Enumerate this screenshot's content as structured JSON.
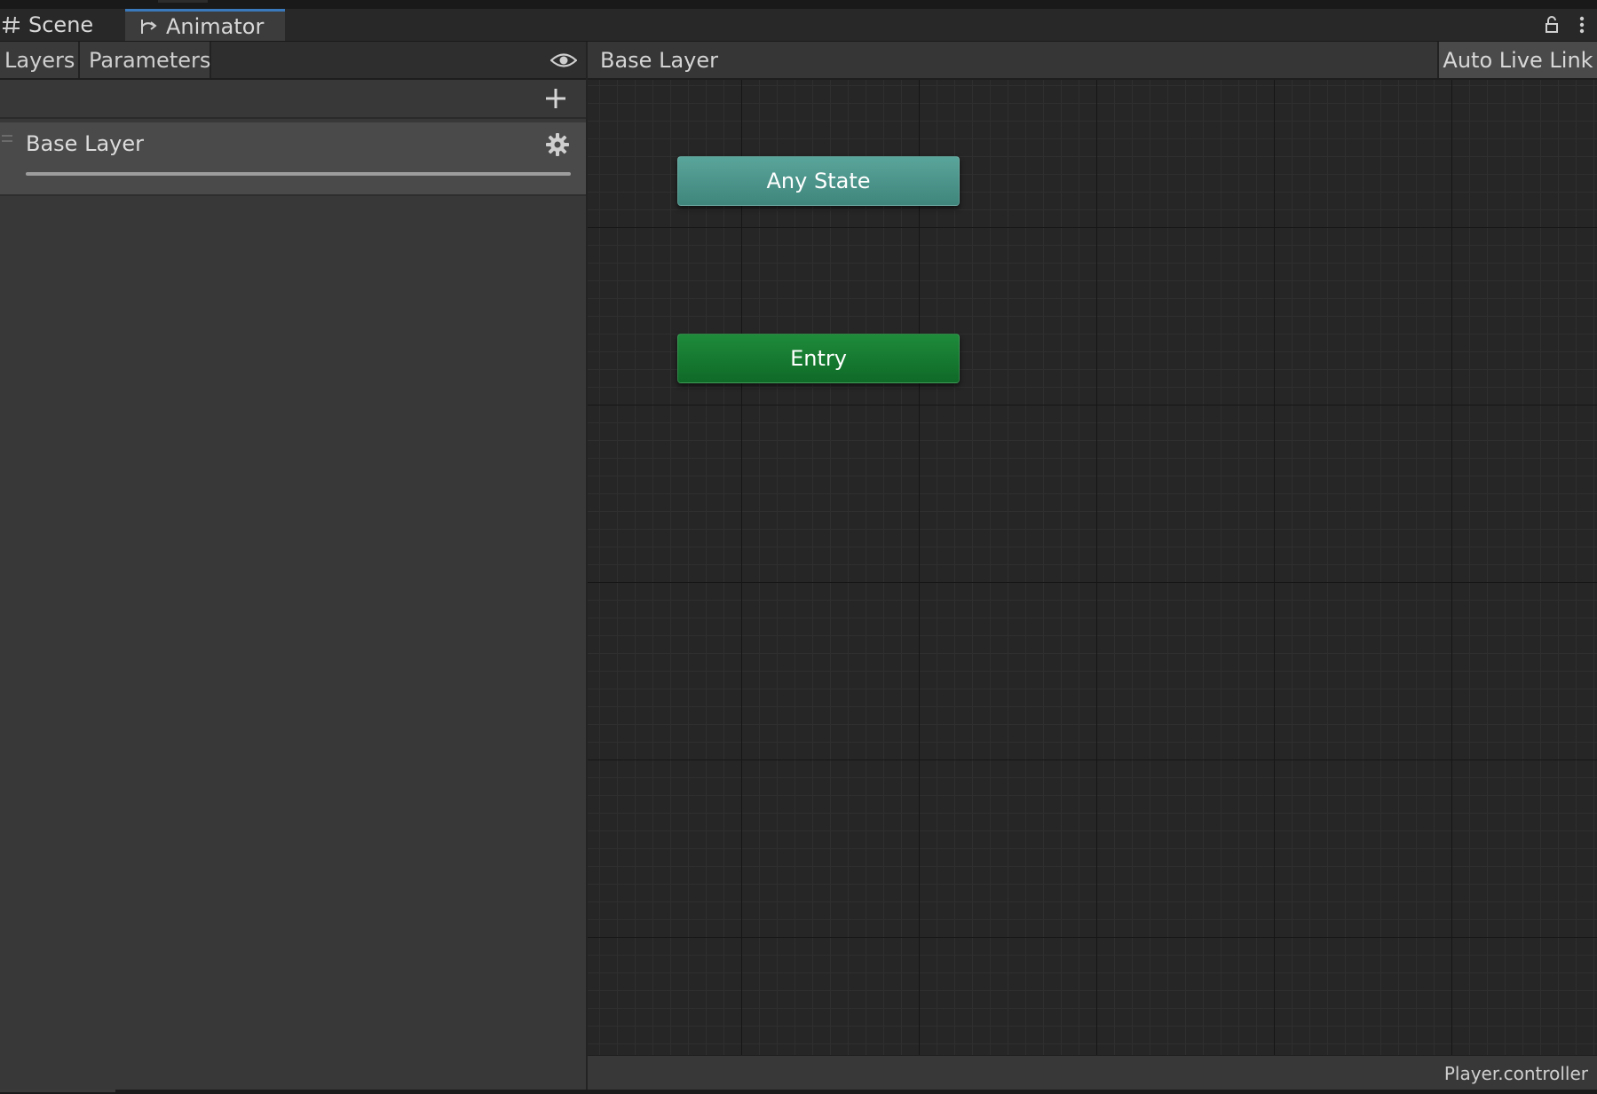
{
  "tabs": [
    {
      "label": "Scene",
      "icon": "grid-icon"
    },
    {
      "label": "Animator",
      "icon": "animator-icon",
      "active": true
    }
  ],
  "window_controls": [
    "lock-icon",
    "kebab-menu-icon"
  ],
  "left_panel": {
    "tabs": [
      {
        "label": "Layers",
        "active": true
      },
      {
        "label": "Parameters"
      }
    ],
    "eye_icon": "eye-icon",
    "add_icon": "plus-icon",
    "layers": [
      {
        "name": "Base Layer",
        "settings_icon": "gear-icon"
      }
    ]
  },
  "graph": {
    "breadcrumb": [
      "Base Layer"
    ],
    "auto_live_link_label": "Auto Live Link",
    "nodes": [
      {
        "label": "Any State",
        "kind": "any-state",
        "color": "#4f998f"
      },
      {
        "label": "Entry",
        "kind": "entry",
        "color": "#177d33"
      }
    ],
    "asset_path": "Player.controller"
  },
  "colors": {
    "accent_tab": "#3a79bb",
    "panel_bg": "#383838",
    "graph_bg": "#262626"
  }
}
